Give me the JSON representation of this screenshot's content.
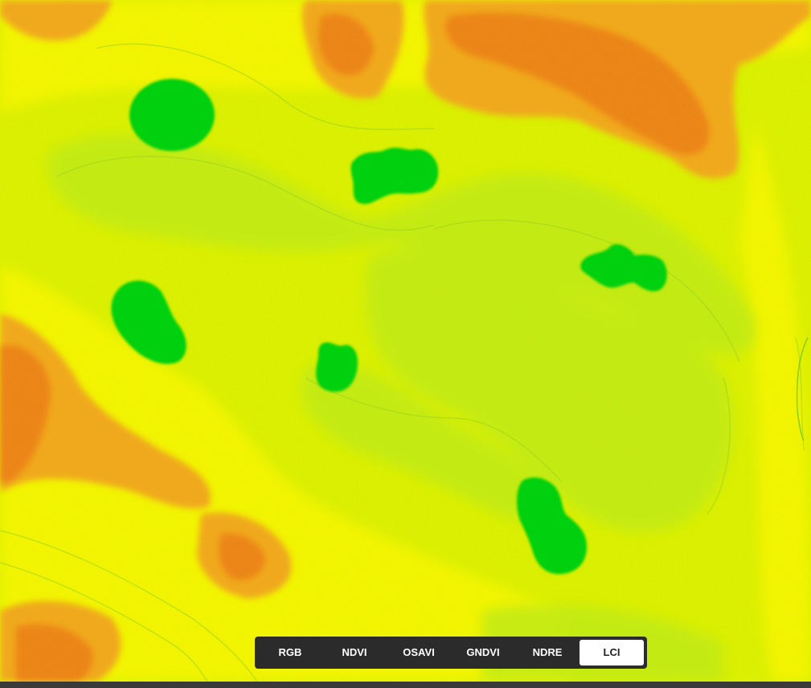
{
  "map": {
    "colors": {
      "base": "#d8f000",
      "yellow": "#f2f500",
      "light_green": "#b6ea1a",
      "orange": "#f0a11e",
      "deep_orange": "#ea7a10",
      "water_green": "#06d10f"
    }
  },
  "layer_switcher": {
    "active": "LCI",
    "buttons": [
      {
        "label": "RGB"
      },
      {
        "label": "NDVI"
      },
      {
        "label": "OSAVI"
      },
      {
        "label": "GNDVI"
      },
      {
        "label": "NDRE"
      },
      {
        "label": "LCI"
      }
    ]
  }
}
